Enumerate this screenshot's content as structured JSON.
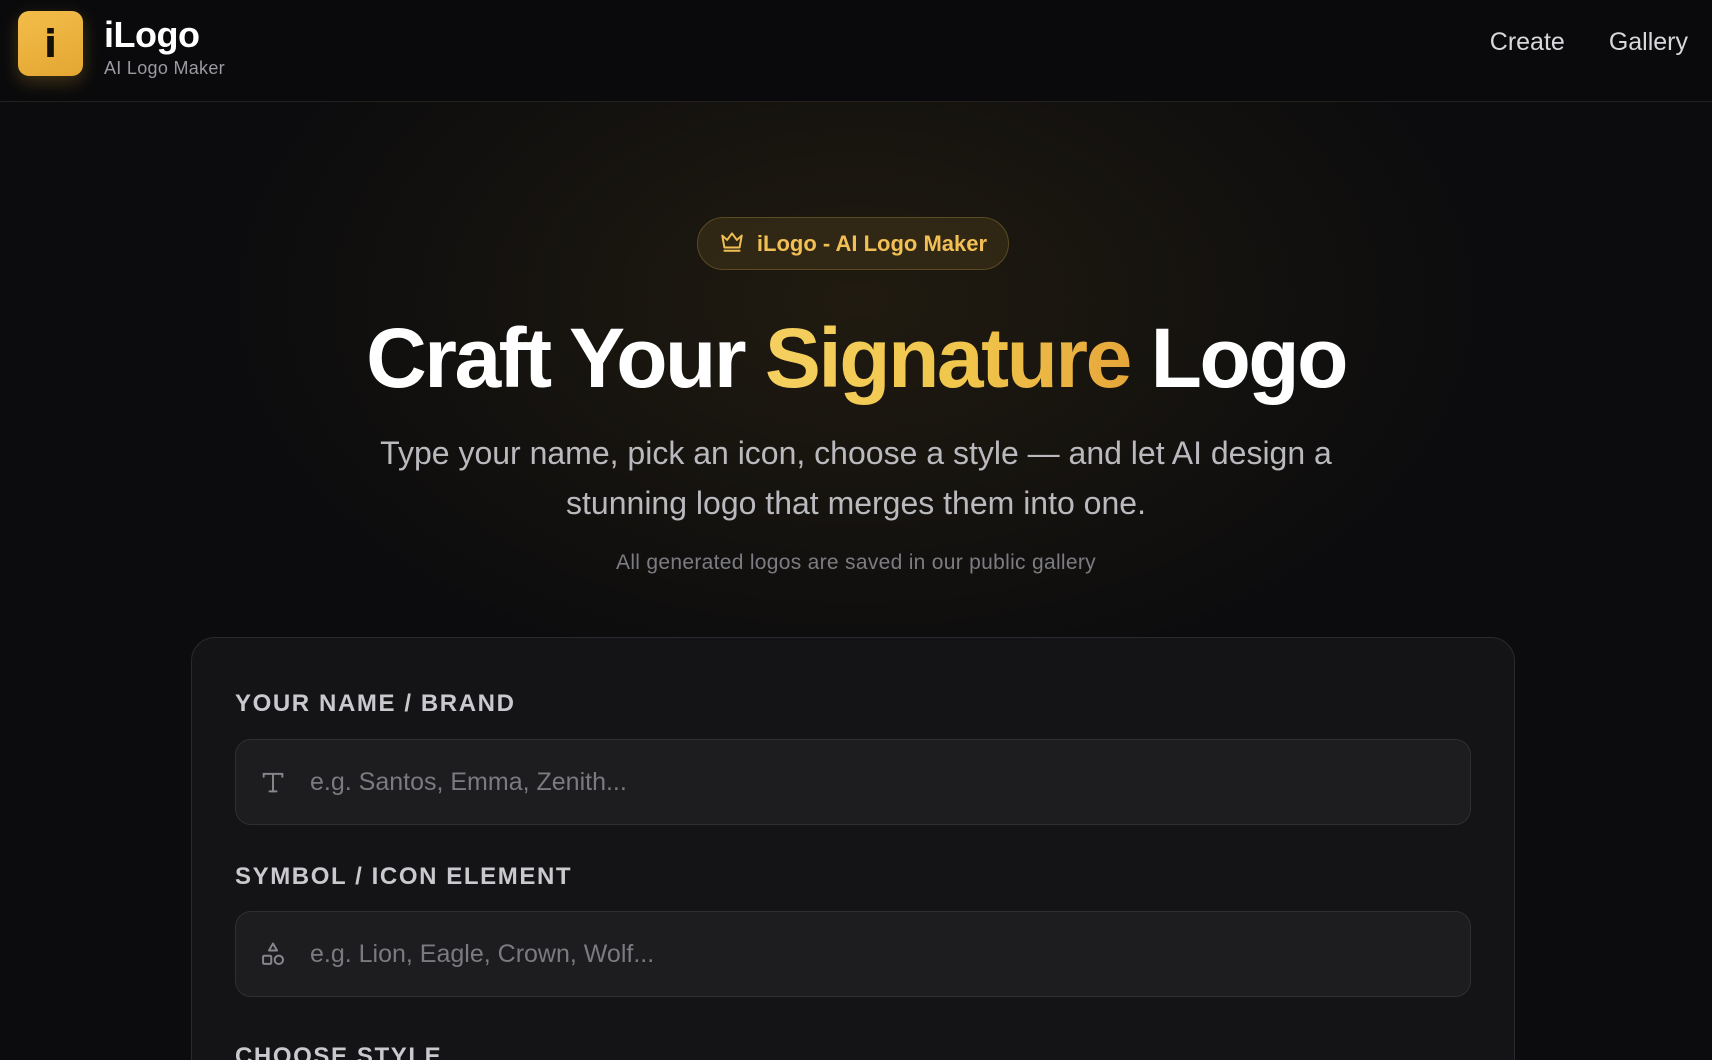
{
  "header": {
    "logo_letter": "i",
    "title": "iLogo",
    "subtitle": "AI Logo Maker",
    "nav": [
      {
        "label": "Create"
      },
      {
        "label": "Gallery"
      }
    ]
  },
  "hero": {
    "badge_icon": "crown-icon",
    "badge_text": "iLogo - AI Logo Maker",
    "title_part1": "Craft Your",
    "title_accent": "Signature",
    "title_part2": "Logo",
    "description": "Type your name, pick an icon, choose a style — and let AI design a stunning logo that merges them into one.",
    "note": "All generated logos are saved in our public gallery"
  },
  "form": {
    "name_label": "YOUR NAME / BRAND",
    "name_placeholder": "e.g. Santos, Emma, Zenith...",
    "name_value": "",
    "symbol_label": "SYMBOL / ICON ELEMENT",
    "symbol_placeholder": "e.g. Lion, Eagle, Crown, Wolf...",
    "symbol_value": "",
    "style_label": "CHOOSE STYLE"
  },
  "colors": {
    "accent": "#f0c64b",
    "accent_dark": "#e6a63a",
    "background": "#0c0c0e",
    "card": "#141416"
  }
}
